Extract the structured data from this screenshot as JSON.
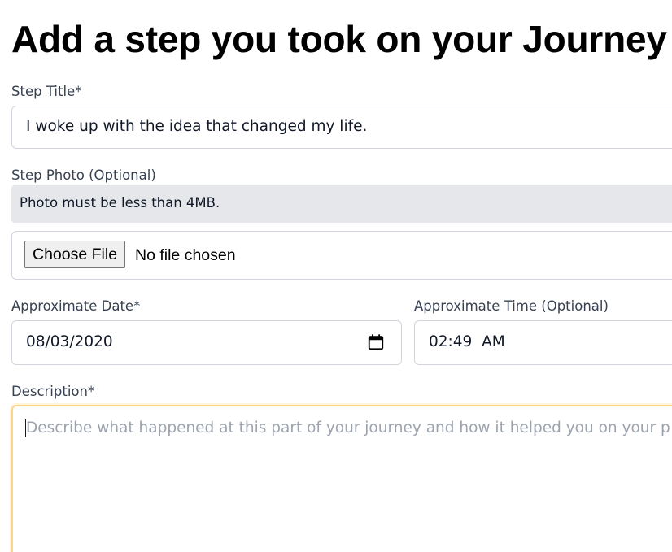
{
  "page": {
    "title": "Add a step you took on your Journey"
  },
  "form": {
    "step_title": {
      "label": "Step Title*",
      "value": "I woke up with the idea that changed my life."
    },
    "step_photo": {
      "label": "Step Photo (Optional)",
      "note": "Photo must be less than 4MB.",
      "button_label": "Choose File",
      "status": "No file chosen"
    },
    "date": {
      "label": "Approximate Date*",
      "value": "08/03/2020",
      "icon": "calendar-icon"
    },
    "time": {
      "label": "Approximate Time (Optional)",
      "value": "02:49  AM"
    },
    "description": {
      "label": "Description*",
      "placeholder": "Describe what happened at this part of your journey and how it helped you on your p"
    }
  },
  "colors": {
    "focus_border": "#fcd58a",
    "note_background": "#e5e7eb",
    "placeholder": "#9ca3af"
  }
}
